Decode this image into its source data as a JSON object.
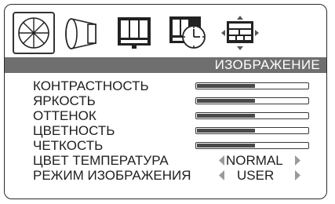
{
  "menu": {
    "tabs": [
      {
        "id": "picture",
        "icon": "aperture-icon",
        "active": true
      },
      {
        "id": "sound",
        "icon": "speaker-icon",
        "active": false
      },
      {
        "id": "function",
        "icon": "function-icon",
        "active": false
      },
      {
        "id": "time",
        "icon": "clock-icon",
        "active": false
      },
      {
        "id": "screen",
        "icon": "screen-icon",
        "active": false
      }
    ],
    "title": "ИЗОБРАЖЕНИЕ"
  },
  "items": [
    {
      "label": "КОНТРАСТНОСТЬ",
      "level": 0.52
    },
    {
      "label": "ЯРКОСТЬ",
      "level": 0.52
    },
    {
      "label": "ОТТЕНОК",
      "level": 0.52
    },
    {
      "label": "ЦВЕТНОСТЬ",
      "level": 0.52
    },
    {
      "label": "ЧЕТКОСТЬ",
      "level": 0.52
    },
    {
      "label": "ЦВЕТ ТЕМПЕРАТУРА",
      "value": "NORMAL"
    },
    {
      "label": "РЕЖИМ ИЗОБРАЖЕНИЯ",
      "value": "USER"
    }
  ],
  "colors": {
    "title_bar": "#6f6f6f",
    "bar_fill": "#4a4a4a",
    "arrow": "#9a9a9a"
  }
}
